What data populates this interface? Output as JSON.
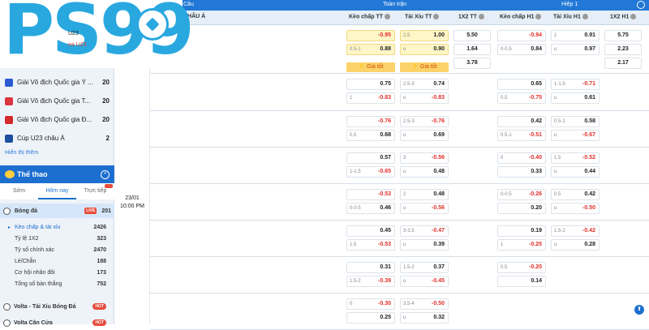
{
  "logo": {
    "text": "PS99"
  },
  "leagues": [
    {
      "name": "Giải Vô địch Quốc gia Ý ...",
      "count": "20",
      "color": "#2a5bd1"
    },
    {
      "name": "Giải Vô địch Quốc gia T...",
      "count": "20",
      "color": "#d9363e"
    },
    {
      "name": "Giải Vô địch Quốc gia Đ...",
      "count": "20",
      "color": "#d42a2a"
    },
    {
      "name": "Cúp U23 châu Á",
      "count": "2",
      "color": "#1d4fa0"
    }
  ],
  "show_more": "Hiển thị thêm",
  "sports": {
    "title": "Thể thao"
  },
  "tabs": [
    "Sớm",
    "Hôm nay",
    "Trực tiếp"
  ],
  "sport_row": {
    "name": "Bóng đá",
    "live": "LIVE",
    "count": "201"
  },
  "sub_items": [
    {
      "label": "Kèo chấp & tài xỉu",
      "count": "2426"
    },
    {
      "label": "Tỷ lệ 1X2",
      "count": "323"
    },
    {
      "label": "Tỷ số chính xác",
      "count": "2470"
    },
    {
      "label": "Lẻ/Chẵn",
      "count": "188"
    },
    {
      "label": "Cơ hội nhân đôi",
      "count": "173"
    },
    {
      "label": "Tổng số bàn thắng",
      "count": "752"
    }
  ],
  "extra_items": [
    {
      "name": "Volta - Tài Xỉu Bóng Đá",
      "badge": "HOT"
    },
    {
      "name": "Volta Cân Cửa",
      "badge": "HOT"
    }
  ],
  "header": {
    "left": "Cầu",
    "full": "Toàn trận",
    "half": "Hiệp 1",
    "league": "CHÂU Á",
    "cols": [
      "Kèo chấp TT",
      "Tài Xỉu TT",
      "1X2 TT",
      "Kèo chấp H1",
      "Tài Xỉu H1",
      "1X2 H1"
    ]
  },
  "match": {
    "date": "23/01",
    "time": "10:00 PM",
    "team1": "U23",
    "team2": "ea U23"
  },
  "gia_tot": "⚡ Giá tốt",
  "rows": [
    {
      "hc": [
        "",
        "-0.95",
        "0.5-1",
        "0.88"
      ],
      "ou": [
        "2.5",
        "1.00",
        "u",
        "0.90"
      ],
      "x12": [
        "5.50",
        "1.64",
        "3.78"
      ],
      "hc1": [
        "",
        "-0.94",
        "0-0.5",
        "0.84"
      ],
      "ou1": [
        "1",
        "0.91",
        "u",
        "0.97"
      ],
      "x121": [
        "5.75",
        "2.23",
        "2.17"
      ]
    },
    {
      "hc": [
        "",
        "0.75",
        "1",
        "-0.83"
      ],
      "ou": [
        "2.5-3",
        "0.74",
        "u",
        "-0.83"
      ],
      "hc1": [
        "",
        "0.65",
        "0.5",
        "-0.75"
      ],
      "ou1": [
        "1-1.5",
        "-0.71",
        "u",
        "0.61"
      ]
    },
    {
      "hc": [
        "",
        "-0.76",
        "0.5",
        "0.68"
      ],
      "ou": [
        "2.5-3",
        "-0.76",
        "u",
        "0.69"
      ],
      "hc1": [
        "",
        "0.42",
        "0.5-1",
        "-0.51"
      ],
      "ou1": [
        "0.5-1",
        "0.58",
        "u",
        "-0.67"
      ]
    },
    {
      "hc": [
        "",
        "0.57",
        "1-1.5",
        "-0.65"
      ],
      "ou": [
        "3",
        "-0.56",
        "u",
        "0.48"
      ],
      "hc1": [
        "0",
        "-0.40",
        "",
        "0.33"
      ],
      "ou1": [
        "1.5",
        "-0.52",
        "u",
        "0.44"
      ]
    },
    {
      "hc": [
        "",
        "-0.53",
        "0-0.5",
        "0.46"
      ],
      "ou": [
        "2",
        "0.48",
        "u",
        "-0.56"
      ],
      "hc1": [
        "0-0.5",
        "-0.26",
        "",
        "0.20"
      ],
      "ou1": [
        "0.5",
        "0.42",
        "u",
        "-0.50"
      ]
    },
    {
      "hc": [
        "",
        "0.45",
        "1.5",
        "-0.53"
      ],
      "ou": [
        "3-3.5",
        "-0.47",
        "u",
        "0.39"
      ],
      "hc1": [
        "",
        "0.19",
        "1",
        "-0.25"
      ],
      "ou1": [
        "1.5-2",
        "-0.42",
        "u",
        "0.28"
      ]
    },
    {
      "hc": [
        "",
        "0.31",
        "1.5-2",
        "-0.39"
      ],
      "ou": [
        "1.5-2",
        "0.37",
        "u",
        "-0.45"
      ],
      "hc1": [
        "0.5",
        "-0.20",
        "",
        "0.14"
      ],
      "ou1": [
        "",
        "",
        "",
        " "
      ]
    },
    {
      "hc": [
        "0",
        "-0.30",
        "",
        "0.25"
      ],
      "ou": [
        "3.5-4",
        "-0.50",
        "u",
        "0.32"
      ],
      "hc1": [
        "",
        "",
        "",
        ""
      ],
      "ou1": [
        "",
        "",
        "",
        ""
      ]
    }
  ]
}
